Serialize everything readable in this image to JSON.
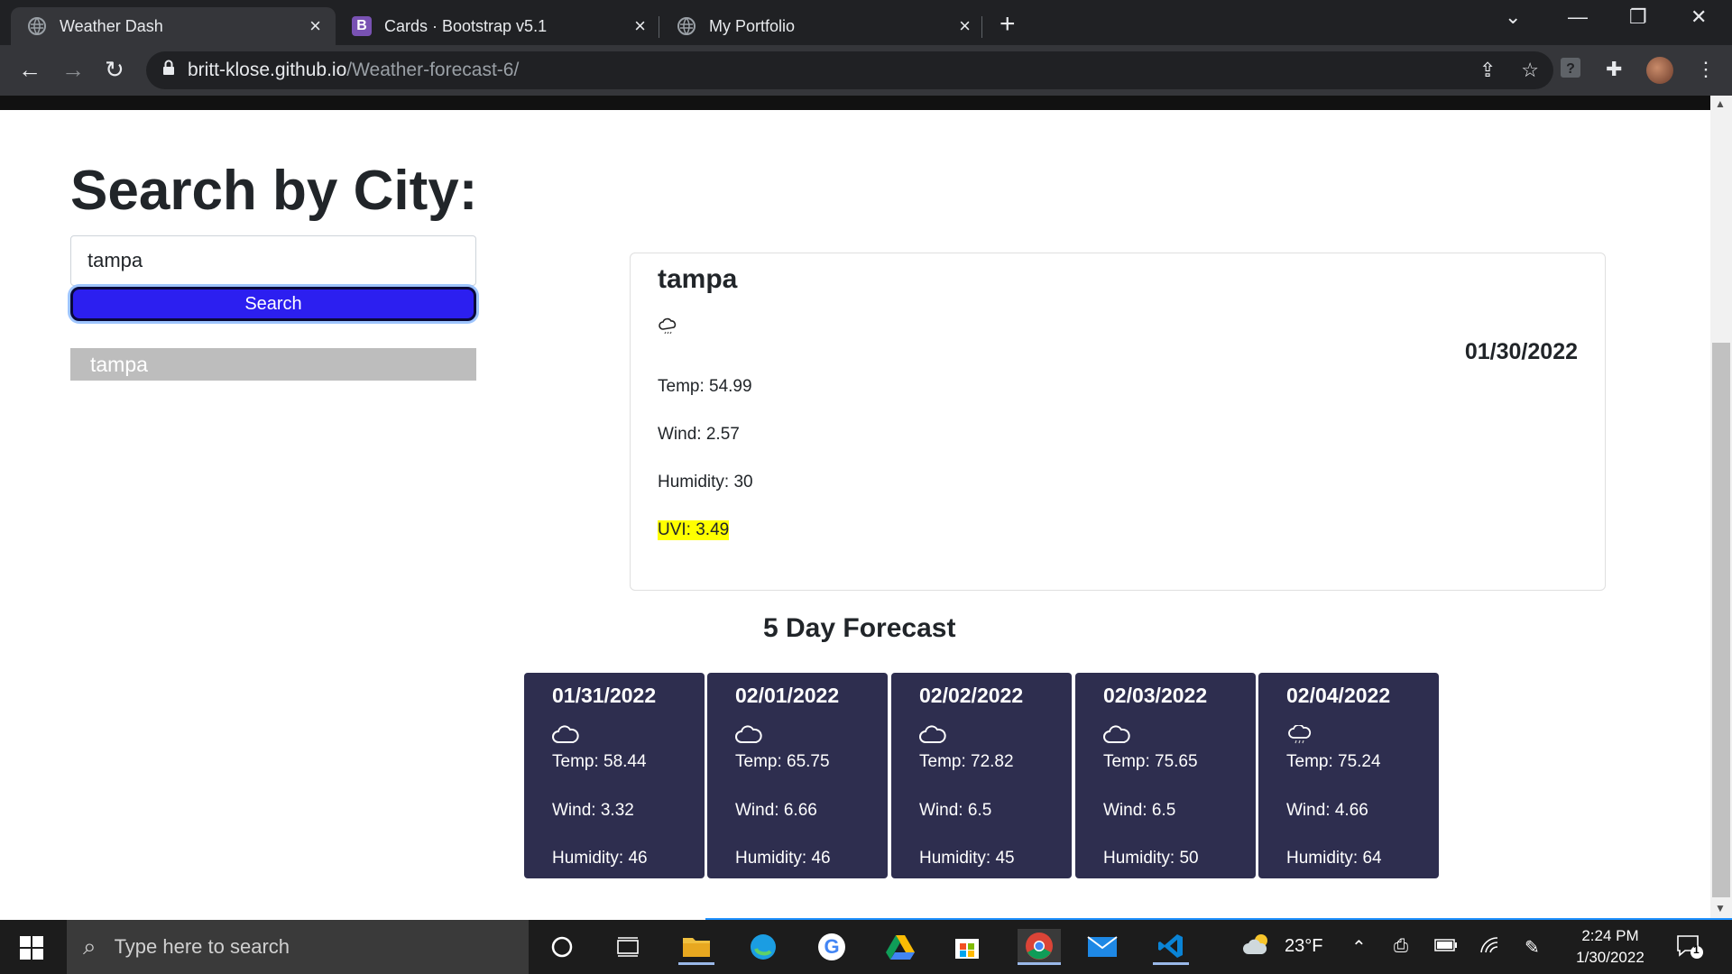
{
  "browser": {
    "tabs": [
      {
        "title": "Weather Dash",
        "icon": "globe-icon"
      },
      {
        "title": "Cards · Bootstrap v5.1",
        "icon": "bootstrap-icon",
        "icon_letter": "B"
      },
      {
        "title": "My Portfolio",
        "icon": "globe-icon"
      }
    ],
    "url_host": "britt-klose.github.io",
    "url_path": "/Weather-forecast-6/"
  },
  "sidebar": {
    "title": "Search by City:",
    "search_value": "tampa",
    "search_button": "Search",
    "history": [
      "tampa"
    ]
  },
  "current": {
    "city": "tampa",
    "date": "01/30/2022",
    "temp": "Temp: 54.99",
    "wind": "Wind: 2.57",
    "humidity": "Humidity: 30",
    "uvi": "UVI: 3.49",
    "uvi_color": "#ffff00"
  },
  "forecast": {
    "title": "5 Day Forecast",
    "card_color": "#2e2e4f",
    "days": [
      {
        "date": "01/31/2022",
        "icon": "cloud-icon",
        "temp": "Temp: 58.44",
        "wind": "Wind: 3.32",
        "humidity": "Humidity: 46"
      },
      {
        "date": "02/01/2022",
        "icon": "cloud-icon",
        "temp": "Temp: 65.75",
        "wind": "Wind: 6.66",
        "humidity": "Humidity: 46"
      },
      {
        "date": "02/02/2022",
        "icon": "cloud-icon",
        "temp": "Temp: 72.82",
        "wind": "Wind: 6.5",
        "humidity": "Humidity: 45"
      },
      {
        "date": "02/03/2022",
        "icon": "cloud-icon",
        "temp": "Temp: 75.65",
        "wind": "Wind: 6.5",
        "humidity": "Humidity: 50"
      },
      {
        "date": "02/04/2022",
        "icon": "rain-cloud-icon",
        "temp": "Temp: 75.24",
        "wind": "Wind: 4.66",
        "humidity": "Humidity: 64"
      }
    ]
  },
  "taskbar": {
    "search_placeholder": "Type here to search",
    "weather_temp": "23°F",
    "time": "2:24 PM",
    "date": "1/30/2022",
    "notification_count": "1"
  }
}
